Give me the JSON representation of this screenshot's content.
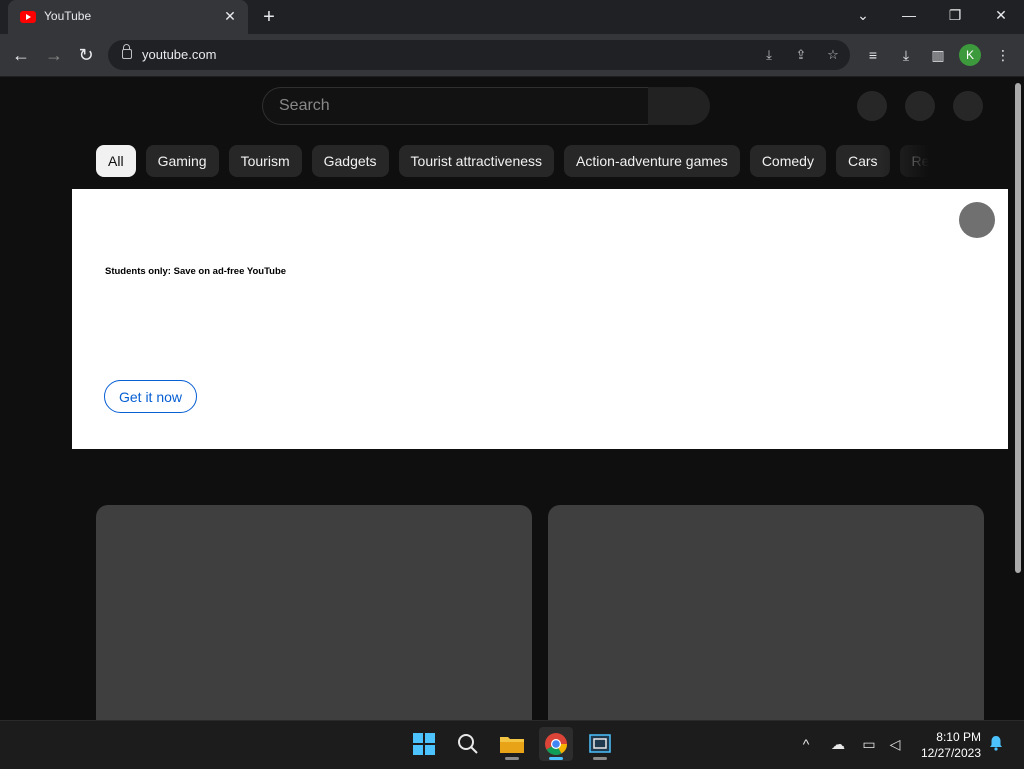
{
  "browser": {
    "tab_title": "YouTube",
    "tab_close": "✕",
    "new_tab": "+",
    "url": "youtube.com",
    "profile_initial": "K"
  },
  "youtube": {
    "search_placeholder": "Search",
    "chips": [
      "All",
      "Gaming",
      "Tourism",
      "Gadgets",
      "Tourist attractiveness",
      "Action-adventure games",
      "Comedy",
      "Cars",
      "Re"
    ],
    "banner_text": "Students only: Save on ad-free YouTube",
    "banner_cta": "Get it now"
  },
  "taskbar": {
    "time": "8:10 PM",
    "date": "12/27/2023"
  }
}
